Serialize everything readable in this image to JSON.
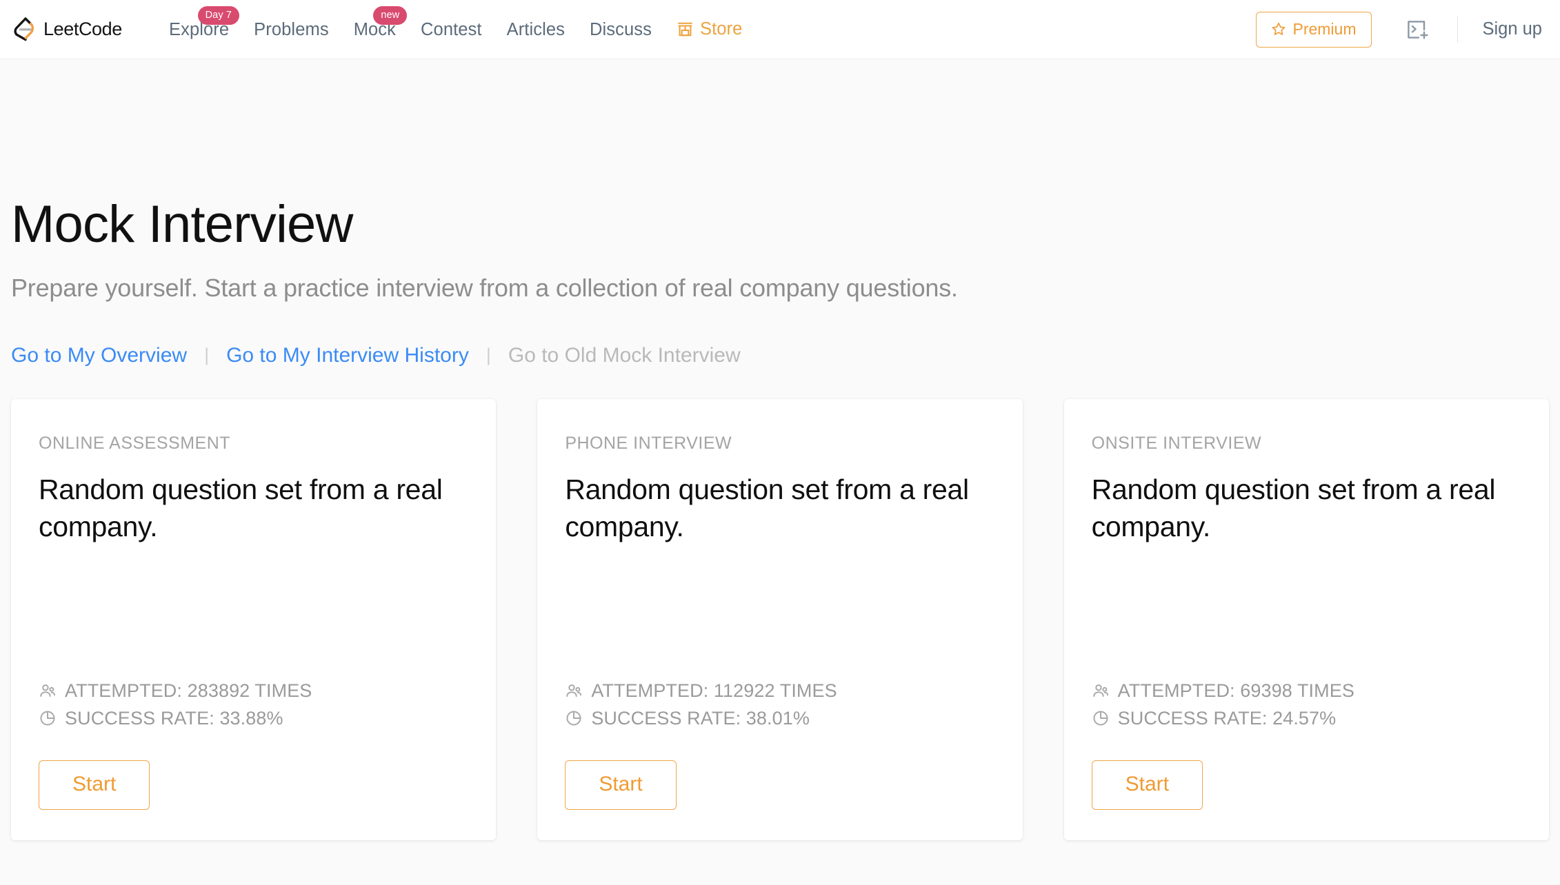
{
  "nav": {
    "logo": {
      "icon": "leetcode-logo-icon",
      "wordmark": "LeetCode"
    },
    "items": [
      {
        "label": "Explore",
        "badge": "Day 7",
        "icon": null
      },
      {
        "label": "Problems",
        "badge": null,
        "icon": null
      },
      {
        "label": "Mock",
        "badge": "new",
        "icon": null
      },
      {
        "label": "Contest",
        "badge": null,
        "icon": null
      },
      {
        "label": "Articles",
        "badge": null,
        "icon": null
      },
      {
        "label": "Discuss",
        "badge": null,
        "icon": null
      },
      {
        "label": "Store",
        "badge": null,
        "icon": "store-icon"
      }
    ],
    "premium_label": "Premium",
    "premium_icon": "star-icon",
    "console_icon": "console-plus-icon",
    "signup_label": "Sign up"
  },
  "header": {
    "title": "Mock Interview",
    "subtitle": "Prepare yourself. Start a practice interview from a collection of real company questions."
  },
  "links": [
    {
      "label": "Go to My Overview",
      "disabled": false
    },
    {
      "label": "Go to My Interview History",
      "disabled": false
    },
    {
      "label": "Go to Old Mock Interview",
      "disabled": true
    }
  ],
  "link_separator": "|",
  "cards": [
    {
      "kicker": "ONLINE ASSESSMENT",
      "title": "Random question set from a real company.",
      "attempted": "ATTEMPTED: 283892 TIMES",
      "success_rate": "SUCCESS RATE: 33.88%",
      "attempted_icon": "people-icon",
      "success_icon": "pie-chart-icon",
      "start_label": "Start"
    },
    {
      "kicker": "PHONE INTERVIEW",
      "title": "Random question set from a real company.",
      "attempted": "ATTEMPTED: 112922 TIMES",
      "success_rate": "SUCCESS RATE: 38.01%",
      "attempted_icon": "people-icon",
      "success_icon": "pie-chart-icon",
      "start_label": "Start"
    },
    {
      "kicker": "ONSITE INTERVIEW",
      "title": "Random question set from a real company.",
      "attempted": "ATTEMPTED: 69398 TIMES",
      "success_rate": "SUCCESS RATE: 24.57%",
      "attempted_icon": "people-icon",
      "success_icon": "pie-chart-icon",
      "start_label": "Start"
    }
  ],
  "colors": {
    "accent_orange": "#ef9b34",
    "badge_pink": "#d94a6f",
    "link_blue": "#3a8bf5",
    "nav_text": "#5c6b7a",
    "muted_gray": "#9a9a9a",
    "page_bg": "#fafafa"
  }
}
